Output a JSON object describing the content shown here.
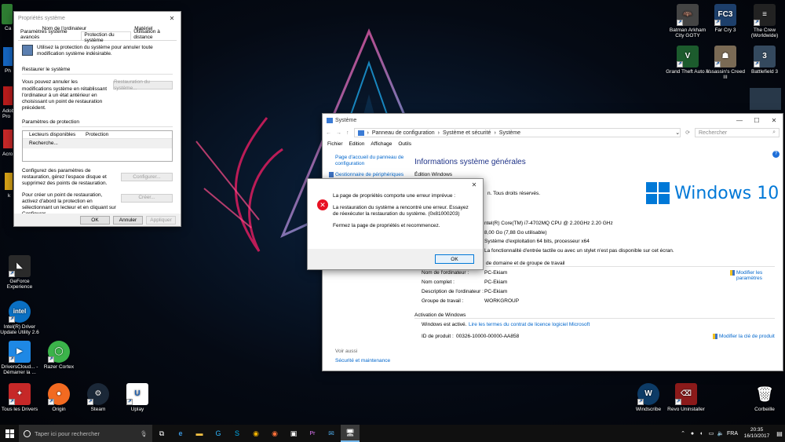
{
  "desktop_icons_left": [
    {
      "label": "GeForce Experience",
      "icon": "geforce-icon",
      "color": "#2a2a2a"
    },
    {
      "label": "Intel(R) Driver Update Utility 2.6",
      "icon": "intel-icon",
      "color": "#0a6fc2"
    },
    {
      "label": "DriversCloud... - Démarrer la ...",
      "icon": "driverscloud-icon",
      "color": "#1e88e5"
    },
    {
      "label": "Razer Cortex",
      "icon": "razer-icon",
      "color": "#3bb34a"
    },
    {
      "label": "Tous les Drivers",
      "icon": "drivers-icon",
      "color": "#c62828"
    },
    {
      "label": "Origin",
      "icon": "origin-icon",
      "color": "#f26a21"
    },
    {
      "label": "Steam",
      "icon": "steam-icon",
      "color": "#1b2838"
    },
    {
      "label": "Uplay",
      "icon": "uplay-icon",
      "color": "#ffffff"
    }
  ],
  "desktop_icons_left_partial": [
    "Ca",
    "Ph",
    "Adob Pro",
    "Acro",
    "k"
  ],
  "desktop_icons_right": [
    {
      "label": "Batman Arkham City GOTY",
      "icon": "batman-icon",
      "color": "#444"
    },
    {
      "label": "Far Cry 3",
      "icon": "farcry3-icon",
      "color": "#1d3f6b",
      "text": "FC3"
    },
    {
      "label": "The Crew (Worldwide)",
      "icon": "thecrew-icon",
      "color": "#222"
    },
    {
      "label": "Grand Theft Auto V",
      "icon": "gta-icon",
      "color": "#1c5b2d"
    },
    {
      "label": "Assassin's Creed III",
      "icon": "ac3-icon",
      "color": "#7a6a55"
    },
    {
      "label": "Battlefield 3",
      "icon": "bf3-icon",
      "color": "#34495e"
    },
    {
      "label": "Windscribe",
      "icon": "windscribe-icon",
      "color": "#0d3b66"
    },
    {
      "label": "Revo Uninstaller",
      "icon": "revo-icon",
      "color": "#8b1a1a"
    },
    {
      "label": "Corbeille",
      "icon": "recycle-bin-icon",
      "color": "#9aa"
    }
  ],
  "sysprops": {
    "title": "Propriétés système",
    "tabs_row1": [
      "Nom de l'ordinateur",
      "Matériel"
    ],
    "tabs_row2": [
      "Paramètres système avancés",
      "Protection du système",
      "Utilisation à distance"
    ],
    "intro": "Utilisez la protection du système pour annuler toute modification système indésirable.",
    "restore_heading": "Restaurer le système",
    "restore_text": "Vous pouvez annuler les modifications système en rétablissant l'ordinateur à un état antérieur en choisissant un point de restauration précédent.",
    "restore_button": "Restauration du système...",
    "protection_heading": "Paramètres de protection",
    "col_drives": "Lecteurs disponibles",
    "col_protection": "Protection",
    "searching": "Recherche...",
    "configure_text": "Configurez des paramètres de restauration, gérez l'espace disque et supprimez des points de restauration.",
    "configure_button": "Configurer...",
    "create_text": "Pour créer un point de restauration, activez d'abord la protection en sélectionnant un lecteur et en cliquant sur Configurer.",
    "create_button": "Créer...",
    "ok": "OK",
    "cancel": "Annuler",
    "apply": "Appliquer"
  },
  "system": {
    "title": "Système",
    "breadcrumb": [
      "Panneau de configuration",
      "Système et sécurité",
      "Système"
    ],
    "search_placeholder": "Rechercher",
    "menu": [
      "Fichier",
      "Edition",
      "Affichage",
      "Outils"
    ],
    "left_links": [
      "Page d'accueil du panneau de configuration",
      "Gestionnaire de périphériques"
    ],
    "see_also": "Voir aussi",
    "security_link": "Sécurité et maintenance",
    "heading": "Informations système générales",
    "edition_label": "Édition Windows",
    "copyright": "n. Tous droits réservés.",
    "logo": "Windows 10",
    "processor": "ntel(R) Core(TM) i7-4702MQ CPU @ 2.20GHz   2.20 GHz",
    "ram": "8,00 Go (7,88 Go utilisable)",
    "os_type": "Système d'exploitation 64 bits, processeur x64",
    "touch": "La fonctionnalité d'entrée tactile ou avec un stylet n'est pas disponible sur cet écran.",
    "domain_heading": "de domaine et de groupe de travail",
    "computer_name_label": "Nom de l'ordinateur :",
    "computer_name": "PC-Ekiam",
    "full_name_label": "Nom complet :",
    "full_name": "PC-Ekiam",
    "description_label": "Description de l'ordinateur :",
    "description": "PC-Ekiam",
    "workgroup_label": "Groupe de travail :",
    "workgroup": "WORKGROUP",
    "change_settings": "Modifier les paramètres",
    "activation_heading": "Activation de Windows",
    "activated": "Windows est activé.",
    "license_link": "Lire les termes du contrat de licence logiciel Microsoft",
    "product_id_label": "ID de produit :",
    "product_id": "00326-10000-00000-AA858",
    "change_key": "Modifier la clé de produit"
  },
  "error_dialog": {
    "line1": "La page de propriétés comporte une erreur imprévue :",
    "line2": "La restauration du système a rencontré une erreur. Essayez de réexécuter la restauration du système. (0x81000203)",
    "line3": "Fermez la page de propriétés et recommencez.",
    "ok": "OK"
  },
  "taskbar": {
    "search_placeholder": "Taper ici pour rechercher",
    "lang": "FRA",
    "time": "20:35",
    "date": "16/10/2017"
  }
}
